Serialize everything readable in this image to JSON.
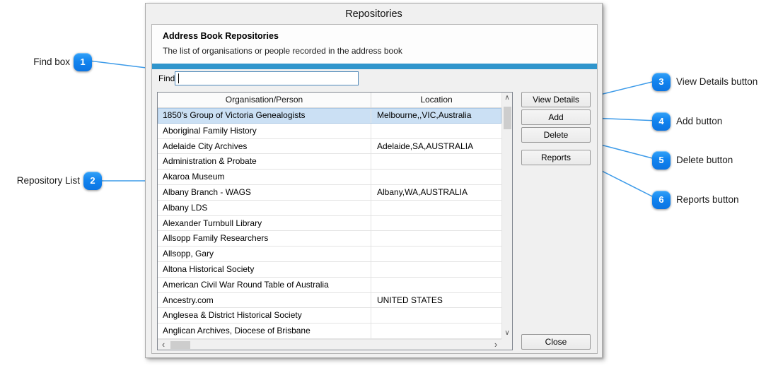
{
  "dialog": {
    "title": "Repositories",
    "header": {
      "title": "Address Book Repositories",
      "subtitle": "The list of organisations or people recorded in the address book"
    },
    "find": {
      "label": "Find",
      "value": ""
    },
    "table": {
      "columns": [
        "Organisation/Person",
        "Location"
      ],
      "rows": [
        {
          "org": "1850's Group of Victoria Genealogists",
          "location": "Melbourne,,VIC,Australia",
          "selected": true
        },
        {
          "org": "Aboriginal Family History",
          "location": ""
        },
        {
          "org": "Adelaide City Archives",
          "location": "Adelaide,SA,AUSTRALIA"
        },
        {
          "org": "Administration & Probate",
          "location": ""
        },
        {
          "org": "Akaroa Museum",
          "location": ""
        },
        {
          "org": "Albany Branch - WAGS",
          "location": "Albany,WA,AUSTRALIA"
        },
        {
          "org": "Albany LDS",
          "location": ""
        },
        {
          "org": "Alexander Turnbull Library",
          "location": ""
        },
        {
          "org": "Allsopp Family Researchers",
          "location": ""
        },
        {
          "org": "Allsopp, Gary",
          "location": ""
        },
        {
          "org": "Altona Historical Society",
          "location": ""
        },
        {
          "org": "American Civil War Round Table of Australia",
          "location": ""
        },
        {
          "org": "Ancestry.com",
          "location": "UNITED STATES"
        },
        {
          "org": "Anglesea & District Historical Society",
          "location": ""
        },
        {
          "org": "Anglican Archives, Diocese of Brisbane",
          "location": ""
        }
      ]
    },
    "buttons": {
      "view_details": "View Details",
      "add": "Add",
      "delete": "Delete",
      "reports": "Reports",
      "close": "Close"
    },
    "scrollbar_icons": {
      "up": "∧",
      "down": "∨",
      "left": "‹",
      "right": "›"
    }
  },
  "callouts": [
    {
      "num": "1",
      "label": "Find box"
    },
    {
      "num": "2",
      "label": "Repository List"
    },
    {
      "num": "3",
      "label": "View Details button"
    },
    {
      "num": "4",
      "label": "Add button"
    },
    {
      "num": "5",
      "label": "Delete button"
    },
    {
      "num": "6",
      "label": "Reports button"
    }
  ],
  "colors": {
    "accent_bar": "#3095cc",
    "badge_blue": "#1284ef",
    "callout_line": "#3d9be9",
    "selection_fill": "#cbe0f4",
    "focus_border": "#4a86b8"
  }
}
